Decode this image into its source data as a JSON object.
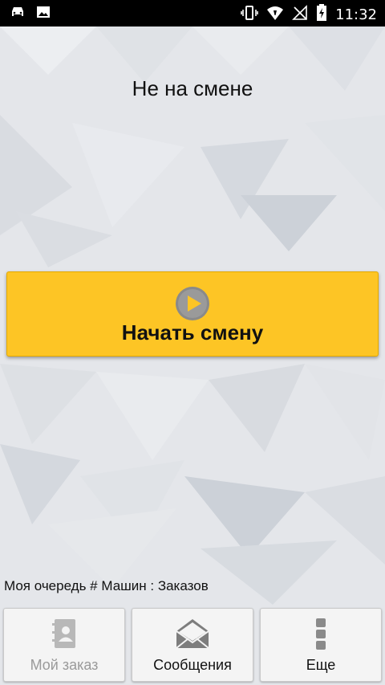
{
  "status_bar": {
    "time": "11:32",
    "icons": [
      "car-icon",
      "image-icon",
      "vibrate-icon",
      "wifi-icon",
      "no-signal-icon",
      "battery-charging-icon"
    ]
  },
  "main": {
    "status_title": "Не на смене",
    "start_button_label": "Начать смену",
    "queue_text": "Моя очередь # Машин : Заказов"
  },
  "bottom_nav": {
    "my_order": "Мой заказ",
    "messages": "Сообщения",
    "more": "Еще"
  },
  "colors": {
    "accent": "#fdc525",
    "statusbar": "#000000",
    "background": "#e5e7eb"
  }
}
